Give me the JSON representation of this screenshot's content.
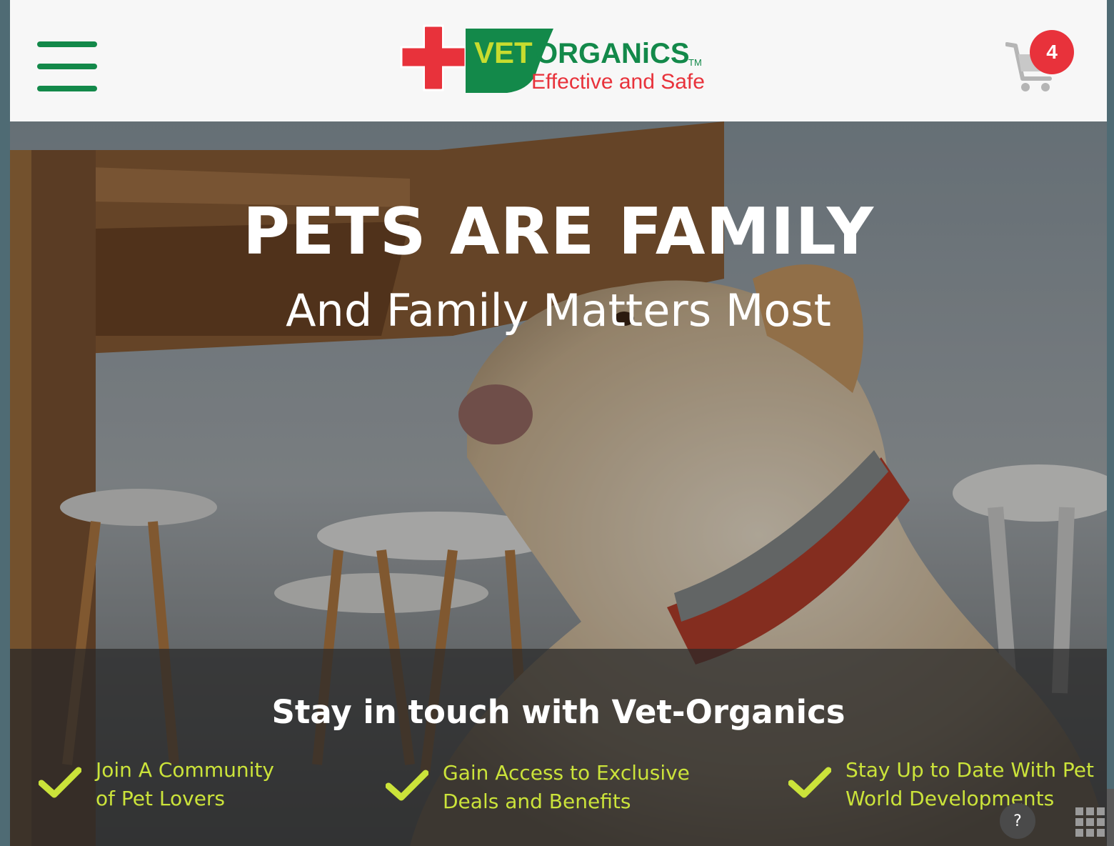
{
  "header": {
    "logo": {
      "brand_part1": "VET",
      "brand_part2": "ORGANiCS",
      "trademark": "TM",
      "tagline": "Effective and Safe"
    },
    "cart_count": "4"
  },
  "hero": {
    "title": "PETS ARE FAMILY",
    "subtitle": "And Family Matters Most"
  },
  "newsletter": {
    "title": "Stay in touch with Vet-Organics",
    "benefits": [
      {
        "text": "Join A Community\nof Pet Lovers"
      },
      {
        "text": "Gain Access to Exclusive\nDeals and Benefits"
      },
      {
        "text": "Stay Up to Date With Pet\nWorld Developments"
      }
    ]
  },
  "help_button": "?",
  "colors": {
    "brand_green": "#13894a",
    "brand_red": "#e8323b",
    "accent_lime": "#cbe33a"
  },
  "icons": [
    "menu-icon",
    "cart-icon",
    "check-icon",
    "grid-icon"
  ]
}
